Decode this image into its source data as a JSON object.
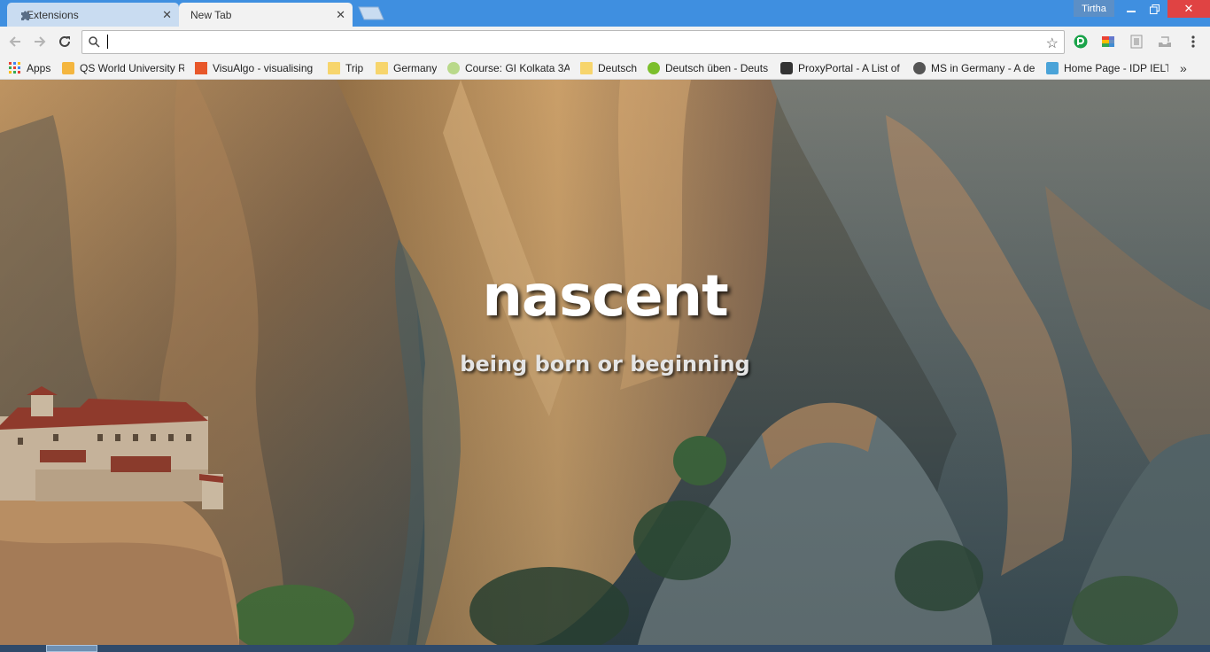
{
  "tabs": [
    {
      "label": "Extensions",
      "active": false,
      "icon": "puzzle-icon"
    },
    {
      "label": "New Tab",
      "active": true
    }
  ],
  "profile": {
    "name": "Tirtha"
  },
  "omnibox": {
    "value": "",
    "placeholder": ""
  },
  "bookmarks": [
    {
      "label": "Apps",
      "icon": "apps-grid-icon"
    },
    {
      "label": "QS World University R",
      "icon": "qs-icon"
    },
    {
      "label": "VisuAlgo - visualising",
      "icon": "nus-icon"
    },
    {
      "label": "Trip",
      "icon": "folder-icon"
    },
    {
      "label": "Germany",
      "icon": "folder-icon"
    },
    {
      "label": "Course: GI Kolkata 3A",
      "icon": "goethe-icon"
    },
    {
      "label": "Deutsch",
      "icon": "folder-icon"
    },
    {
      "label": "Deutsch üben - Deuts",
      "icon": "deutsch-icon"
    },
    {
      "label": "ProxyPortal - A List of",
      "icon": "proxy-icon"
    },
    {
      "label": "MS in Germany - A de",
      "icon": "ms-icon"
    },
    {
      "label": "Home Page - IDP IELT",
      "icon": "idp-icon"
    }
  ],
  "newtab": {
    "word": "nascent",
    "meaning": "being born or beginning"
  },
  "colors": {
    "titlebar": "#3f8fe0",
    "close_button": "#e04343",
    "toolbar": "#f2f2f2"
  }
}
